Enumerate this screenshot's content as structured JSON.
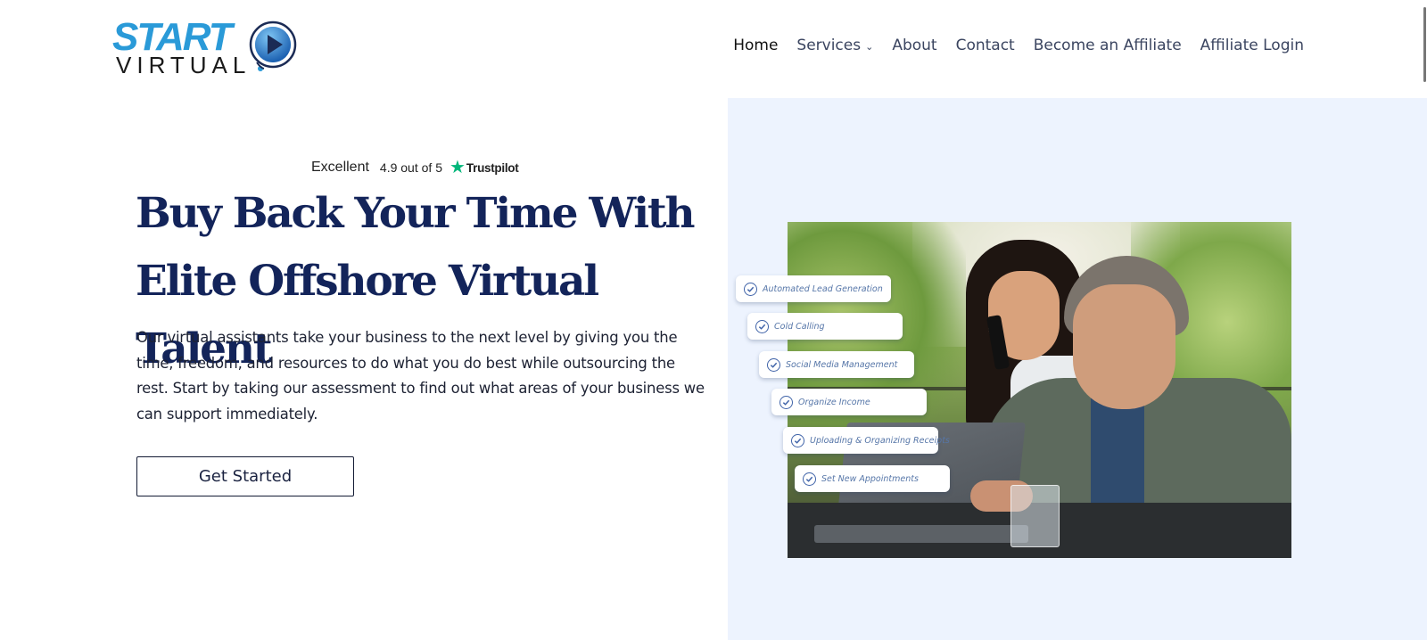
{
  "header": {
    "logo": {
      "line1": "START",
      "line2": "VIRTUAL",
      "icon": "play-icon"
    },
    "nav": [
      {
        "label": "Home",
        "active": true
      },
      {
        "label": "Services",
        "has_dropdown": true,
        "dropdown_icon": "chevron-down-icon"
      },
      {
        "label": "About"
      },
      {
        "label": "Contact"
      },
      {
        "label": "Become an Affiliate"
      },
      {
        "label": "Affiliate Login"
      }
    ],
    "chevron": "⌄"
  },
  "hero": {
    "rating": {
      "label": "Excellent",
      "score": "4.9 out of 5",
      "star": "★",
      "brand": "Trustpilot"
    },
    "headline_line1": "Buy Back Your Time With",
    "headline_line2": "Elite Offshore Virtual Talent",
    "body": "Our virtual assistants take your business to the next level by giving you the time, freedom, and resources to do what you do best while outsourcing the rest. Start by taking our assessment to find out what areas of your business we can support immediately.",
    "cta_label": "Get Started"
  },
  "image_panel": {
    "tasks": [
      "Automated Lead Generation",
      "Cold Calling",
      "Social Media Management",
      "Organize Income",
      "Uploading & Organizing Receipts",
      "Set New Appointments"
    ],
    "task_icon": "check-circle-icon"
  },
  "colors": {
    "accent_blue": "#2a9ad8",
    "headline_navy": "#13245a",
    "panel_bg": "#edf3fe",
    "trustpilot_green": "#00b67a",
    "task_text": "#5676a8"
  }
}
